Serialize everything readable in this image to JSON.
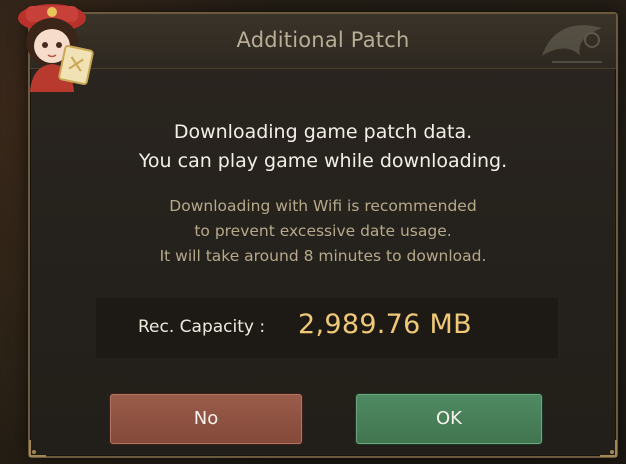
{
  "dialog": {
    "title": "Additional Patch",
    "message_lines": [
      "Downloading game patch data.",
      "You can play game while downloading."
    ],
    "notice_lines": [
      "Downloading with Wifi is recommended",
      "to prevent excessive date usage.",
      "It will take around 8 minutes to download."
    ],
    "capacity_label": "Rec. Capacity :",
    "capacity_value": "2,989.76 MB"
  },
  "buttons": {
    "no_label": "No",
    "ok_label": "OK"
  },
  "colors": {
    "accent_gold": "#f0c978",
    "button_no": "#8e5242",
    "button_ok": "#478058",
    "dialog_bg": "#27231d"
  },
  "icons": {
    "mascot": "chibi-character-icon",
    "corner_ornament": "ornament-icon"
  }
}
